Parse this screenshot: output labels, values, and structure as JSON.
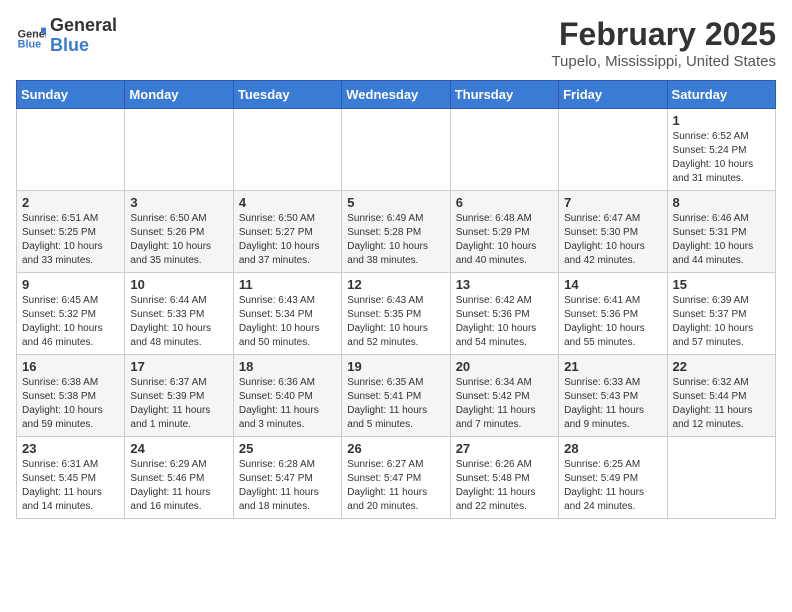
{
  "header": {
    "logo_general": "General",
    "logo_blue": "Blue",
    "main_title": "February 2025",
    "subtitle": "Tupelo, Mississippi, United States"
  },
  "days_of_week": [
    "Sunday",
    "Monday",
    "Tuesday",
    "Wednesday",
    "Thursday",
    "Friday",
    "Saturday"
  ],
  "weeks": [
    [
      {
        "day": "",
        "info": ""
      },
      {
        "day": "",
        "info": ""
      },
      {
        "day": "",
        "info": ""
      },
      {
        "day": "",
        "info": ""
      },
      {
        "day": "",
        "info": ""
      },
      {
        "day": "",
        "info": ""
      },
      {
        "day": "1",
        "info": "Sunrise: 6:52 AM\nSunset: 5:24 PM\nDaylight: 10 hours and 31 minutes."
      }
    ],
    [
      {
        "day": "2",
        "info": "Sunrise: 6:51 AM\nSunset: 5:25 PM\nDaylight: 10 hours and 33 minutes."
      },
      {
        "day": "3",
        "info": "Sunrise: 6:50 AM\nSunset: 5:26 PM\nDaylight: 10 hours and 35 minutes."
      },
      {
        "day": "4",
        "info": "Sunrise: 6:50 AM\nSunset: 5:27 PM\nDaylight: 10 hours and 37 minutes."
      },
      {
        "day": "5",
        "info": "Sunrise: 6:49 AM\nSunset: 5:28 PM\nDaylight: 10 hours and 38 minutes."
      },
      {
        "day": "6",
        "info": "Sunrise: 6:48 AM\nSunset: 5:29 PM\nDaylight: 10 hours and 40 minutes."
      },
      {
        "day": "7",
        "info": "Sunrise: 6:47 AM\nSunset: 5:30 PM\nDaylight: 10 hours and 42 minutes."
      },
      {
        "day": "8",
        "info": "Sunrise: 6:46 AM\nSunset: 5:31 PM\nDaylight: 10 hours and 44 minutes."
      }
    ],
    [
      {
        "day": "9",
        "info": "Sunrise: 6:45 AM\nSunset: 5:32 PM\nDaylight: 10 hours and 46 minutes."
      },
      {
        "day": "10",
        "info": "Sunrise: 6:44 AM\nSunset: 5:33 PM\nDaylight: 10 hours and 48 minutes."
      },
      {
        "day": "11",
        "info": "Sunrise: 6:43 AM\nSunset: 5:34 PM\nDaylight: 10 hours and 50 minutes."
      },
      {
        "day": "12",
        "info": "Sunrise: 6:43 AM\nSunset: 5:35 PM\nDaylight: 10 hours and 52 minutes."
      },
      {
        "day": "13",
        "info": "Sunrise: 6:42 AM\nSunset: 5:36 PM\nDaylight: 10 hours and 54 minutes."
      },
      {
        "day": "14",
        "info": "Sunrise: 6:41 AM\nSunset: 5:36 PM\nDaylight: 10 hours and 55 minutes."
      },
      {
        "day": "15",
        "info": "Sunrise: 6:39 AM\nSunset: 5:37 PM\nDaylight: 10 hours and 57 minutes."
      }
    ],
    [
      {
        "day": "16",
        "info": "Sunrise: 6:38 AM\nSunset: 5:38 PM\nDaylight: 10 hours and 59 minutes."
      },
      {
        "day": "17",
        "info": "Sunrise: 6:37 AM\nSunset: 5:39 PM\nDaylight: 11 hours and 1 minute."
      },
      {
        "day": "18",
        "info": "Sunrise: 6:36 AM\nSunset: 5:40 PM\nDaylight: 11 hours and 3 minutes."
      },
      {
        "day": "19",
        "info": "Sunrise: 6:35 AM\nSunset: 5:41 PM\nDaylight: 11 hours and 5 minutes."
      },
      {
        "day": "20",
        "info": "Sunrise: 6:34 AM\nSunset: 5:42 PM\nDaylight: 11 hours and 7 minutes."
      },
      {
        "day": "21",
        "info": "Sunrise: 6:33 AM\nSunset: 5:43 PM\nDaylight: 11 hours and 9 minutes."
      },
      {
        "day": "22",
        "info": "Sunrise: 6:32 AM\nSunset: 5:44 PM\nDaylight: 11 hours and 12 minutes."
      }
    ],
    [
      {
        "day": "23",
        "info": "Sunrise: 6:31 AM\nSunset: 5:45 PM\nDaylight: 11 hours and 14 minutes."
      },
      {
        "day": "24",
        "info": "Sunrise: 6:29 AM\nSunset: 5:46 PM\nDaylight: 11 hours and 16 minutes."
      },
      {
        "day": "25",
        "info": "Sunrise: 6:28 AM\nSunset: 5:47 PM\nDaylight: 11 hours and 18 minutes."
      },
      {
        "day": "26",
        "info": "Sunrise: 6:27 AM\nSunset: 5:47 PM\nDaylight: 11 hours and 20 minutes."
      },
      {
        "day": "27",
        "info": "Sunrise: 6:26 AM\nSunset: 5:48 PM\nDaylight: 11 hours and 22 minutes."
      },
      {
        "day": "28",
        "info": "Sunrise: 6:25 AM\nSunset: 5:49 PM\nDaylight: 11 hours and 24 minutes."
      },
      {
        "day": "",
        "info": ""
      }
    ]
  ]
}
